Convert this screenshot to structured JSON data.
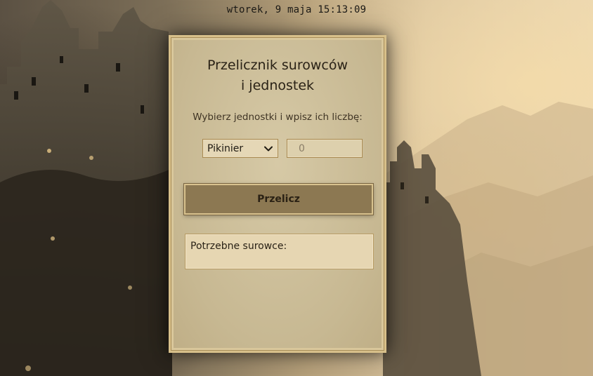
{
  "clock": {
    "datetime": "wtorek, 9 maja 15:13:09"
  },
  "panel": {
    "title_line1": "Przelicznik surowców",
    "title_line2": "i jednostek",
    "instruction": "Wybierz jednostki i wpisz ich liczbę:",
    "unit_select": {
      "selected": "Pikinier"
    },
    "count_input": {
      "placeholder": "0"
    },
    "calc_button_label": "Przelicz",
    "result_label": "Potrzebne surowce:"
  },
  "icons": {
    "select_chevron": "chevron-down-icon"
  }
}
